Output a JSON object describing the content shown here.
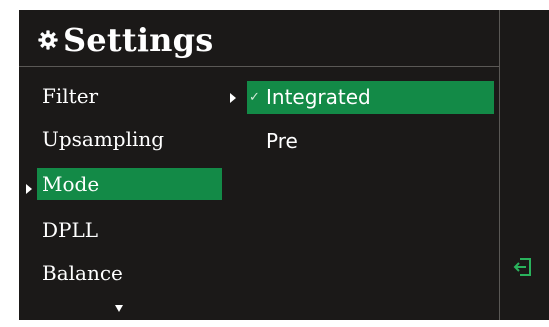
{
  "header": {
    "title": "Settings",
    "icon": "gear-icon"
  },
  "menu": {
    "items": [
      {
        "label": "Filter"
      },
      {
        "label": "Upsampling"
      },
      {
        "label": "Mode"
      },
      {
        "label": "DPLL"
      },
      {
        "label": "Balance"
      }
    ],
    "selected": "Mode"
  },
  "submenu": {
    "items": [
      {
        "label": "Integrated",
        "checked": true
      },
      {
        "label": "Pre",
        "checked": false
      }
    ],
    "check_glyph": "✓"
  },
  "side": {
    "icon": "exit-icon"
  },
  "colors": {
    "accent": "#138a47",
    "background": "#1b1918",
    "exit_icon": "#2ab25c"
  }
}
